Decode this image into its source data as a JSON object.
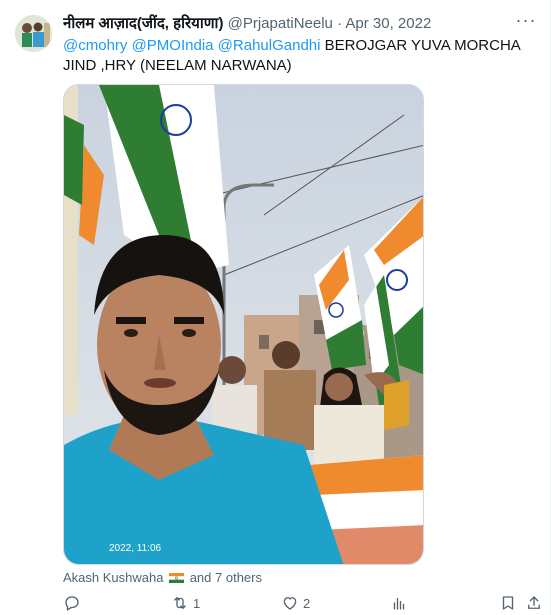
{
  "tweet": {
    "author_name": "नीलम आज़ाद(जींद, हरियाणा)",
    "handle": "@PrjapatiNeelu",
    "separator": "·",
    "date": "Apr 30, 2022",
    "more_label": "···",
    "text_parts": {
      "mention1": "@cmohry",
      "mention2": "@PMOIndia",
      "mention3": "@RahulGandhi",
      "body": "BEROJGAR YUVA MORCHA JIND ,HRY (NEELAM NARWANA)"
    },
    "media_timestamp": "2022, 11:06",
    "likers": {
      "first": "Akash Kushwaha",
      "flag_icon": "india-flag-emoji",
      "rest": "and 7 others"
    },
    "actions": {
      "reply_count": "",
      "retweet_count": "1",
      "like_count": "2",
      "views_count": ""
    }
  },
  "colors": {
    "link": "#1d9bf0",
    "secondary_text": "#536471",
    "saffron": "#f08a2e",
    "green": "#2e7d32",
    "shirt": "#1fa2c9"
  }
}
